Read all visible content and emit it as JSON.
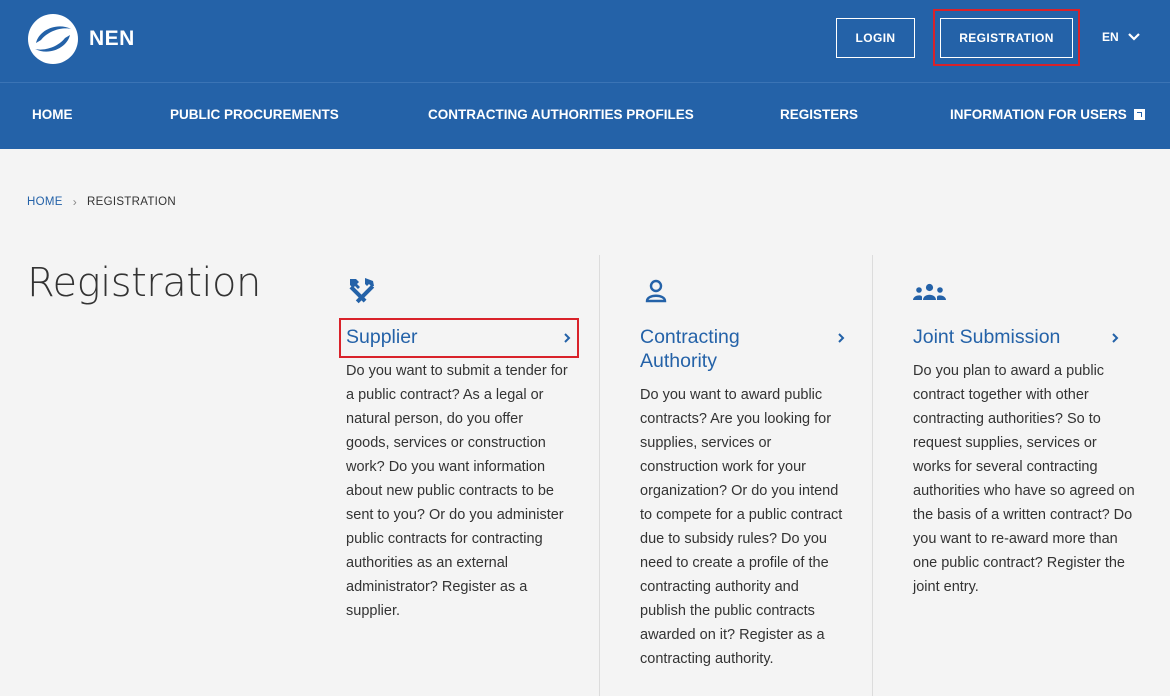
{
  "header": {
    "logo_text": "NEN",
    "login_label": "LOGIN",
    "registration_label": "REGISTRATION",
    "language": "EN"
  },
  "nav": {
    "home": "HOME",
    "public_procurements": "PUBLIC PROCUREMENTS",
    "contracting_authorities_profiles": "CONTRACTING AUTHORITIES PROFILES",
    "registers": "REGISTERS",
    "information_for_users": "INFORMATION FOR USERS"
  },
  "breadcrumb": {
    "home": "HOME",
    "separator": "›",
    "current": "REGISTRATION"
  },
  "page_title": "Registration",
  "cards": {
    "supplier": {
      "icon": "hammer-wrench-icon",
      "title": "Supplier",
      "description": "Do you want to submit a tender for a public contract? As a legal or natural person, do you offer goods, services or construction work? Do you want information about new public contracts to be sent to you? Or do you administer public contracts for contracting authorities as an external administrator? Register as a supplier."
    },
    "contracting_authority": {
      "icon": "person-icon",
      "title": "Contracting Authority",
      "description": "Do you want to award public contracts? Are you looking for supplies, services or construction work for your organization? Or do you intend to compete for a public contract due to subsidy rules? Do you need to create a profile of the contracting authority and publish the public contracts awarded on it? Register as a contracting authority."
    },
    "joint_submission": {
      "icon": "group-icon",
      "title": "Joint Submission",
      "description": "Do you plan to award a public contract together with other contracting authorities? So to request supplies, services or works for several contracting authorities who have so agreed on the basis of a written contract? Do you want to re-award more than one public contract? Register the joint entry."
    }
  },
  "colors": {
    "brand_blue": "#2462a8",
    "highlight_red": "#d9222a",
    "background": "#f4f4f4"
  }
}
